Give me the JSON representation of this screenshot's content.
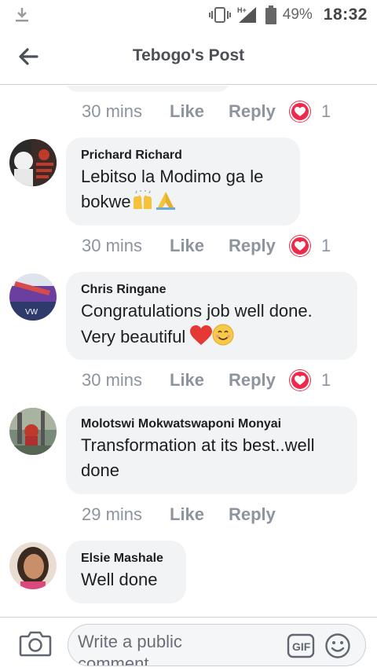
{
  "status_bar": {
    "battery": "49%",
    "time": "18:32",
    "network": "H+",
    "icons": [
      "download-icon",
      "vibrate-icon",
      "signal-icon",
      "battery-icon"
    ]
  },
  "header": {
    "title": "Tebogo's Post",
    "back_icon": "back-arrow-icon"
  },
  "action_labels": {
    "like": "Like",
    "reply": "Reply"
  },
  "top_meta": {
    "time": "30 mins",
    "reaction_count": "1"
  },
  "comments": [
    {
      "author": "Prichard Richard",
      "text": "Lebitso la Modimo ga le bokwe",
      "emojis": [
        "raising-hands-emoji",
        "folded-hands-emoji"
      ],
      "time": "30 mins",
      "reaction_count": "1"
    },
    {
      "author": "Chris Ringane",
      "text_line1": "Congratulations  job well done.",
      "text_line2": "Very beautiful",
      "emojis": [
        "red-heart-emoji",
        "smiling-face-emoji"
      ],
      "time": "30 mins",
      "reaction_count": "1"
    },
    {
      "author": "Molotswi Mokwatswaponi Monyai",
      "text": "Transformation at its best..well done",
      "time": "29 mins"
    },
    {
      "author": "Elsie Mashale",
      "text": "Well done"
    }
  ],
  "composer": {
    "placeholder": "Write a public comment...",
    "icons": [
      "camera-icon",
      "gif-icon",
      "smiley-icon"
    ]
  },
  "colors": {
    "bubble": "#f2f3f5",
    "meta_text": "#8d949e",
    "heart_reaction": "#f0284a",
    "header_text": "#4b4f56"
  }
}
